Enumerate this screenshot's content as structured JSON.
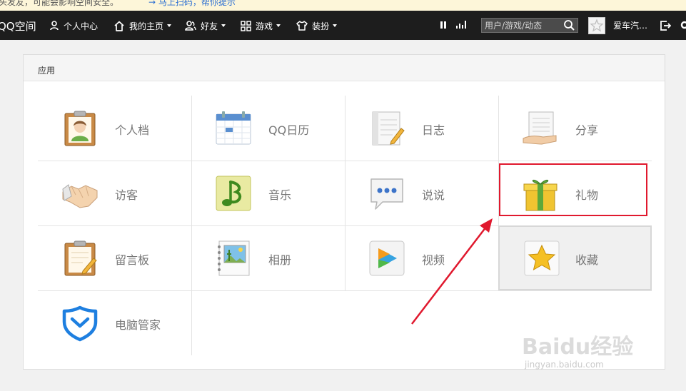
{
  "notice": {
    "text": "头发友，可能会影响空间安全。",
    "link": "→ 马上扫码，帮你提示"
  },
  "topbar": {
    "brand": "QQ空间",
    "nav": [
      {
        "label": "个人中心",
        "icon": "user-icon",
        "has_caret": false
      },
      {
        "label": "我的主页",
        "icon": "home-icon",
        "has_caret": true
      },
      {
        "label": "好友",
        "icon": "friends-icon",
        "has_caret": true
      },
      {
        "label": "游戏",
        "icon": "grid-icon",
        "has_caret": true
      },
      {
        "label": "装扮",
        "icon": "shirt-icon",
        "has_caret": true
      }
    ],
    "search_placeholder": "用户/游戏/动态",
    "username": "爱车汽…"
  },
  "panel": {
    "title": "应用",
    "apps": [
      {
        "label": "个人档",
        "icon": "profile-clipboard-icon"
      },
      {
        "label": "QQ日历",
        "icon": "calendar-icon"
      },
      {
        "label": "日志",
        "icon": "blog-notebook-icon"
      },
      {
        "label": "分享",
        "icon": "share-hand-icon"
      },
      {
        "label": "访客",
        "icon": "handshake-icon"
      },
      {
        "label": "音乐",
        "icon": "music-note-icon"
      },
      {
        "label": "说说",
        "icon": "speech-bubble-icon"
      },
      {
        "label": "礼物",
        "icon": "gift-icon"
      },
      {
        "label": "留言板",
        "icon": "message-board-icon"
      },
      {
        "label": "相册",
        "icon": "photo-album-icon"
      },
      {
        "label": "视频",
        "icon": "video-play-icon"
      },
      {
        "label": "收藏",
        "icon": "star-icon"
      },
      {
        "label": "电脑管家",
        "icon": "pc-manager-shield-icon"
      }
    ],
    "active_app": "收藏",
    "highlighted_app": "礼物"
  },
  "watermark": {
    "text": "Baidu经验",
    "sub": "jingyan.baidu.com"
  },
  "colors": {
    "topbar": "#1d1d1d",
    "highlight": "#e0192e",
    "panel_header": "#f5f5f5"
  }
}
